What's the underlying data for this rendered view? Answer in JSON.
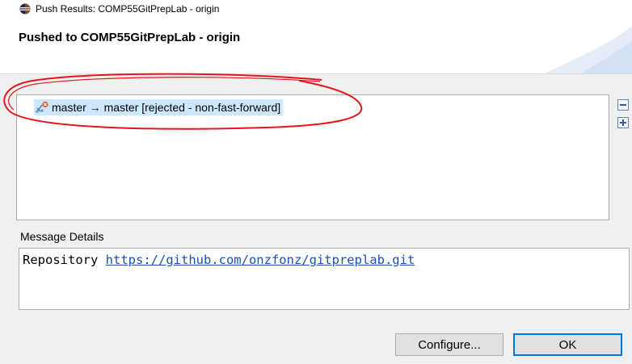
{
  "window": {
    "title": "Push Results: COMP55GitPrepLab - origin",
    "icon": "eclipse-icon"
  },
  "header": {
    "title": "Pushed to COMP55GitPrepLab - origin"
  },
  "results": {
    "items": [
      {
        "label": "master → master [rejected - non-fast-forward]",
        "icon": "push-rejected-icon",
        "selected": true
      }
    ],
    "collapse_all_icon": "collapse-all-icon",
    "expand_all_icon": "expand-all-icon"
  },
  "details": {
    "label": "Message Details",
    "prefix": "Repository",
    "link": "https://github.com/onzfonz/gitpreplab.git"
  },
  "buttons": {
    "configure": "Configure...",
    "ok": "OK"
  },
  "colors": {
    "selection": "#cce8ff",
    "link": "#1a4fb4",
    "annotation": "#e8141b",
    "default_button_border": "#0078d7"
  }
}
